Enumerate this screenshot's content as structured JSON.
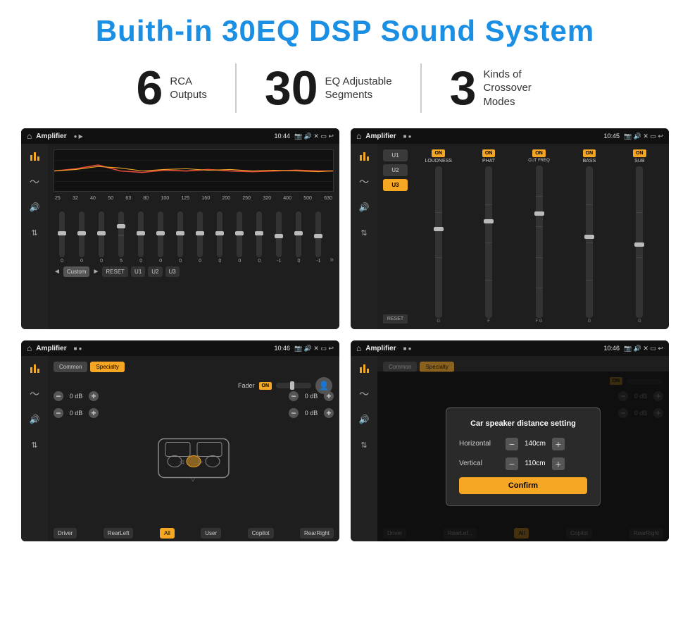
{
  "page": {
    "title": "Buith-in 30EQ DSP Sound System",
    "stats": [
      {
        "number": "6",
        "label": "RCA\nOutputs"
      },
      {
        "number": "30",
        "label": "EQ Adjustable\nSegments"
      },
      {
        "number": "3",
        "label": "Kinds of\nCrossover Modes"
      }
    ]
  },
  "screens": {
    "top_left": {
      "status": {
        "title": "Amplifier",
        "time": "10:44"
      },
      "freq_labels": [
        "25",
        "32",
        "40",
        "50",
        "63",
        "80",
        "100",
        "125",
        "160",
        "200",
        "250",
        "320",
        "400",
        "500",
        "630"
      ],
      "slider_values": [
        "0",
        "0",
        "0",
        "5",
        "0",
        "0",
        "0",
        "0",
        "0",
        "0",
        "0",
        "-1",
        "0",
        "-1"
      ],
      "buttons": [
        "Custom",
        "RESET",
        "U1",
        "U2",
        "U3"
      ]
    },
    "top_right": {
      "status": {
        "title": "Amplifier",
        "time": "10:45"
      },
      "presets": [
        "U1",
        "U2",
        "U3"
      ],
      "channels": [
        {
          "label": "ON",
          "name": "LOUDNESS"
        },
        {
          "label": "ON",
          "name": "PHAT"
        },
        {
          "label": "ON",
          "name": "CUT FREQ"
        },
        {
          "label": "ON",
          "name": "BASS"
        },
        {
          "label": "ON",
          "name": "SUB"
        }
      ]
    },
    "bottom_left": {
      "status": {
        "title": "Amplifier",
        "time": "10:46"
      },
      "tabs": [
        "Common",
        "Specialty"
      ],
      "fader": {
        "label": "Fader",
        "state": "ON"
      },
      "db_values": [
        "0 dB",
        "0 dB",
        "0 dB",
        "0 dB"
      ],
      "buttons": [
        "Driver",
        "RearLeft",
        "All",
        "User",
        "Copilot",
        "RearRight"
      ]
    },
    "bottom_right": {
      "status": {
        "title": "Amplifier",
        "time": "10:46"
      },
      "tabs": [
        "Common",
        "Specialty"
      ],
      "dialog": {
        "title": "Car speaker distance setting",
        "horizontal_label": "Horizontal",
        "horizontal_value": "140cm",
        "vertical_label": "Vertical",
        "vertical_value": "110cm",
        "confirm_label": "Confirm"
      },
      "db_values": [
        "0 dB",
        "0 dB"
      ],
      "buttons": [
        "Driver",
        "RearLeft",
        "All",
        "Copilot",
        "RearRight"
      ]
    }
  }
}
